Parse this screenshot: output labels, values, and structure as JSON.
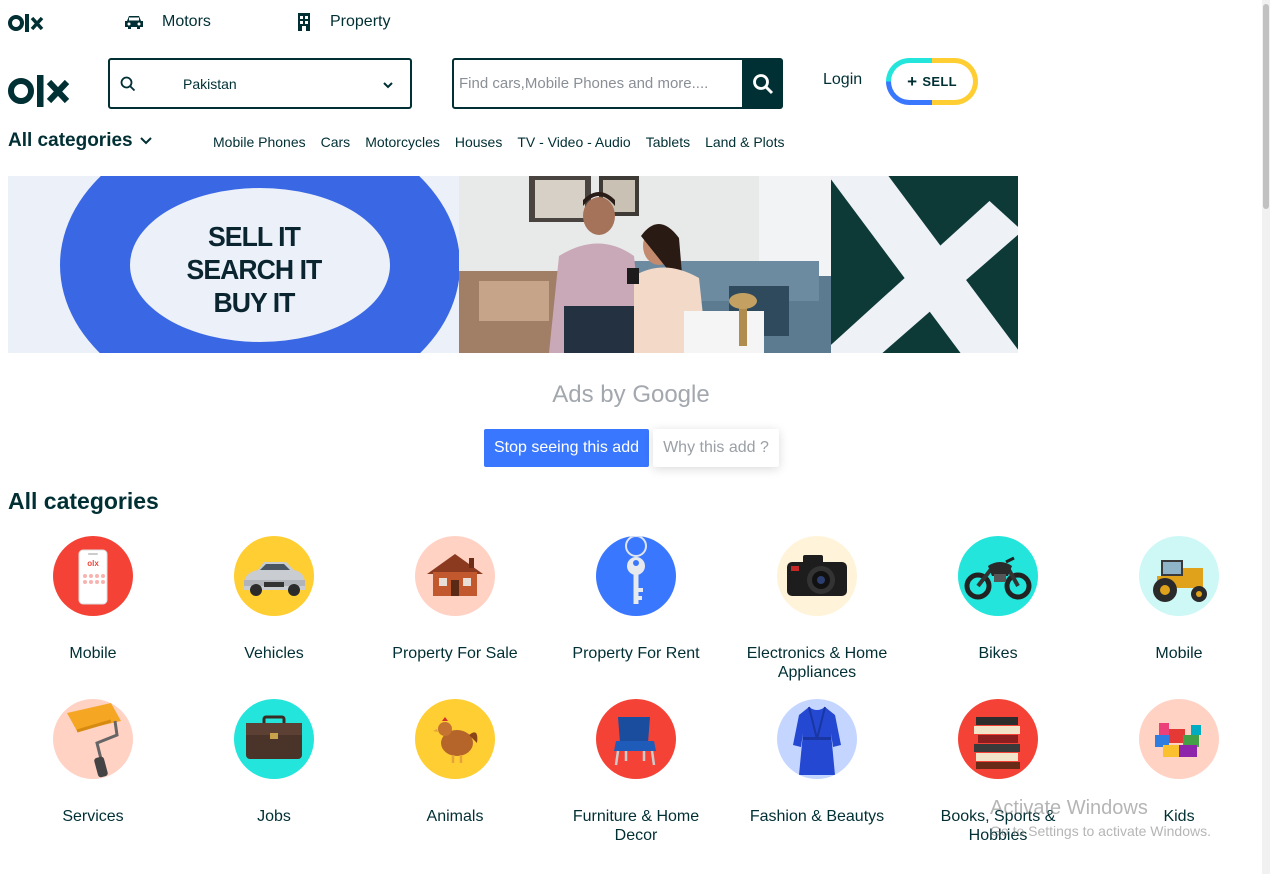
{
  "topnav": {
    "brand": "olx",
    "motors_label": "Motors",
    "property_label": "Property"
  },
  "header": {
    "location_value": "Pakistan",
    "search_placeholder": "Find cars,Mobile Phones and more....",
    "login_label": "Login",
    "sell_label": "SELL"
  },
  "category_nav": {
    "all_label": "All categories",
    "links": [
      "Mobile Phones",
      "Cars",
      "Motorcycles",
      "Houses",
      "TV - Video - Audio",
      "Tablets",
      "Land & Plots"
    ]
  },
  "banner": {
    "slogan": [
      "SELL IT",
      "SEARCH IT",
      "BUY IT"
    ]
  },
  "ads": {
    "title": "Ads by Google",
    "stop_label": "Stop seeing this add",
    "why_label": "Why this add ?"
  },
  "categories": {
    "heading": "All categories",
    "items": [
      {
        "label": "Mobile",
        "icon": "mobile-phone-icon",
        "bg": "#f44336"
      },
      {
        "label": "Vehicles",
        "icon": "car-icon",
        "bg": "#ffce32"
      },
      {
        "label": "Property For Sale",
        "icon": "house-icon",
        "bg": "#ffd2c4"
      },
      {
        "label": "Property For Rent",
        "icon": "key-icon",
        "bg": "#3a77ff"
      },
      {
        "label": "Electronics & Home Appliances",
        "icon": "camera-icon",
        "bg": "#fff4d9"
      },
      {
        "label": "Bikes",
        "icon": "motorbike-icon",
        "bg": "#23e5db"
      },
      {
        "label": "Mobile",
        "icon": "tractor-icon",
        "bg": "#cdf8f6"
      },
      {
        "label": "Services",
        "icon": "paint-roller-icon",
        "bg": "#ffd2c4"
      },
      {
        "label": "Jobs",
        "icon": "briefcase-icon",
        "bg": "#23e5db"
      },
      {
        "label": "Animals",
        "icon": "hen-icon",
        "bg": "#ffce32"
      },
      {
        "label": "Furniture & Home Decor",
        "icon": "chair-icon",
        "bg": "#f44336"
      },
      {
        "label": "Fashion & Beautys",
        "icon": "dress-icon",
        "bg": "#c4d6ff"
      },
      {
        "label": "Books, Sports & Hobbies",
        "icon": "books-icon",
        "bg": "#f44336"
      },
      {
        "label": "Kids",
        "icon": "toy-blocks-icon",
        "bg": "#ffd2c4"
      }
    ]
  },
  "overlay": {
    "watermark_line1": "Activate Windows",
    "watermark_line2": "Go to Settings to activate Windows."
  }
}
